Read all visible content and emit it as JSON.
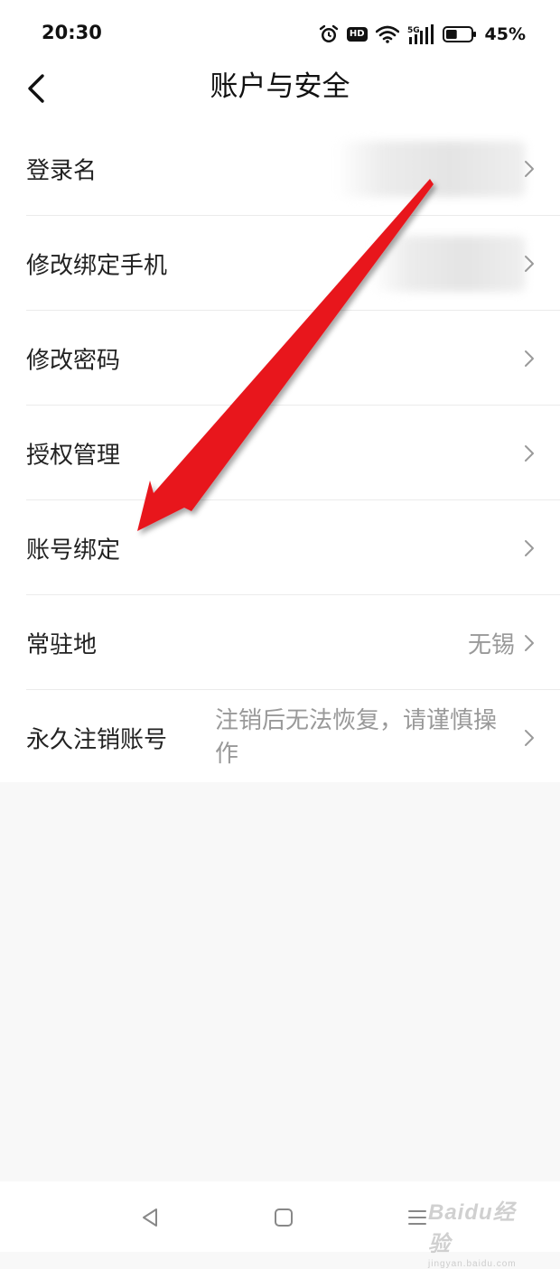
{
  "status_bar": {
    "time": "20:30",
    "hd_label": "HD",
    "network_label": "5G",
    "battery_percent": "45%",
    "battery_level": 0.45,
    "icons": [
      "alarm-icon",
      "hd-icon",
      "wifi-icon",
      "signal-5g-icon",
      "battery-icon"
    ]
  },
  "header": {
    "title": "账户与安全",
    "back_icon": "chevron-left-icon"
  },
  "settings": [
    {
      "label": "登录名",
      "value": null
    },
    {
      "label": "修改绑定手机",
      "value": null
    },
    {
      "label": "修改密码",
      "value": null
    },
    {
      "label": "授权管理",
      "value": null
    },
    {
      "label": "账号绑定",
      "value": null
    },
    {
      "label": "常驻地",
      "value": "无锡"
    },
    {
      "label": "永久注销账号",
      "value": "注销后无法恢复，请谨慎操作"
    }
  ],
  "annotation": {
    "arrow_color": "#e8141c"
  },
  "navigation_bar": {
    "icons": [
      "back-triangle-icon",
      "home-square-icon",
      "menu-lines-icon"
    ]
  },
  "watermark": {
    "brand": "Baidu经验",
    "url": "jingyan.baidu.com"
  }
}
